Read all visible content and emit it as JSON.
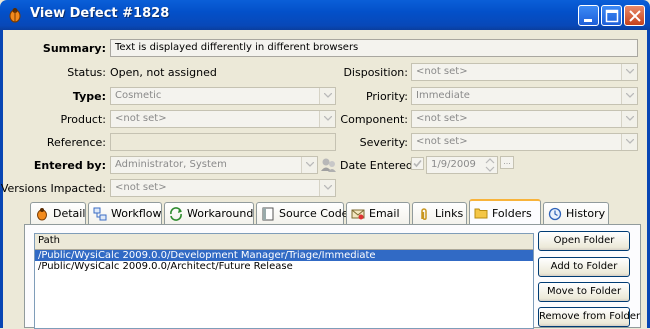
{
  "window": {
    "title": "View Defect #1828",
    "icon": "defect-bug-icon"
  },
  "form": {
    "summary": {
      "label": "Summary:",
      "value": "Text is displayed differently in different browsers"
    },
    "status": {
      "label": "Status:",
      "value": "Open, not assigned"
    },
    "disposition": {
      "label": "Disposition:",
      "value": "<not set>"
    },
    "type": {
      "label": "Type:",
      "value": "Cosmetic"
    },
    "priority": {
      "label": "Priority:",
      "value": "Immediate"
    },
    "product": {
      "label": "Product:",
      "value": "<not set>"
    },
    "component": {
      "label": "Component:",
      "value": "<not set>"
    },
    "reference": {
      "label": "Reference:",
      "value": ""
    },
    "severity": {
      "label": "Severity:",
      "value": "<not set>"
    },
    "entered_by": {
      "label": "Entered by:",
      "value": "Administrator, System"
    },
    "date_entered": {
      "label": "Date Entered:",
      "value": "1/9/2009",
      "checked": true
    },
    "versions_impacted": {
      "label": "Versions Impacted:",
      "value": "<not set>"
    }
  },
  "tabs": [
    {
      "label": "Detail",
      "icon": "bug-icon"
    },
    {
      "label": "Workflow",
      "icon": "workflow-icon"
    },
    {
      "label": "Workaround",
      "icon": "workaround-arrows-icon"
    },
    {
      "label": "Source Code",
      "icon": "source-code-icon"
    },
    {
      "label": "Email",
      "icon": "email-icon"
    },
    {
      "label": "Links",
      "icon": "paperclip-icon"
    },
    {
      "label": "Folders",
      "icon": "folder-icon",
      "active": true
    },
    {
      "label": "History",
      "icon": "history-icon"
    }
  ],
  "folders": {
    "column_header": "Path",
    "rows": [
      "/Public/WysiCalc 2009.0.0/Development Manager/Triage/Immediate",
      "/Public/WysiCalc 2009.0.0/Architect/Future Release"
    ],
    "selected_index": 0,
    "buttons": {
      "open": "Open Folder",
      "add": "Add to Folder",
      "move": "Move to Folder",
      "remove": "Remove from Folder"
    }
  },
  "colors": {
    "titlebar": "#0350c9",
    "selection": "#316ac5",
    "active_tab_accent": "#f8b33a"
  }
}
